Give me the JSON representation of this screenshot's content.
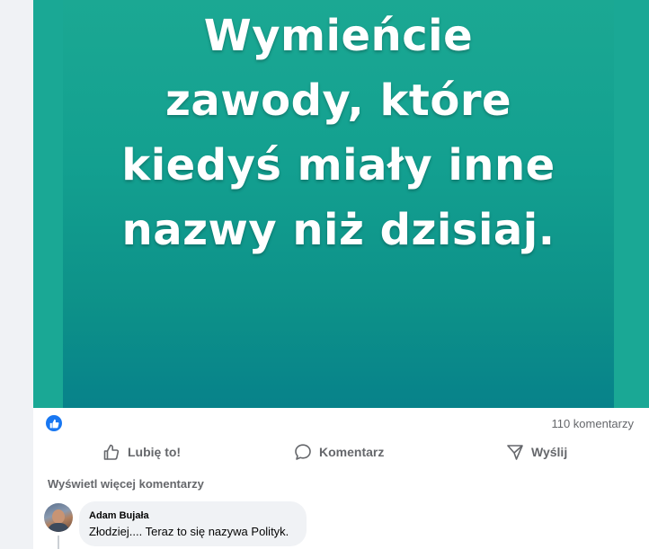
{
  "post": {
    "image_text_lines": [
      "Wymieńcie",
      "zawody, które",
      "kiedyś miały inne",
      "nazwy niż dzisiaj."
    ],
    "image_colors": {
      "outer": "#1aa895",
      "top": "#1ba893",
      "bottom": "#07828a"
    }
  },
  "stats": {
    "reaction_icon": "like-icon",
    "comment_count": "110 komentarzy"
  },
  "actions": {
    "like_label": "Lubię to!",
    "comment_label": "Komentarz",
    "share_label": "Wyślij"
  },
  "comments": {
    "more_label": "Wyświetl więcej komentarzy",
    "items": [
      {
        "author": "Adam Bujała",
        "text": "Złodziej.... Teraz to się nazywa Polityk."
      }
    ]
  },
  "colors": {
    "accent": "#1877f2",
    "secondary_text": "#65676b",
    "bubble": "#f0f2f5"
  }
}
